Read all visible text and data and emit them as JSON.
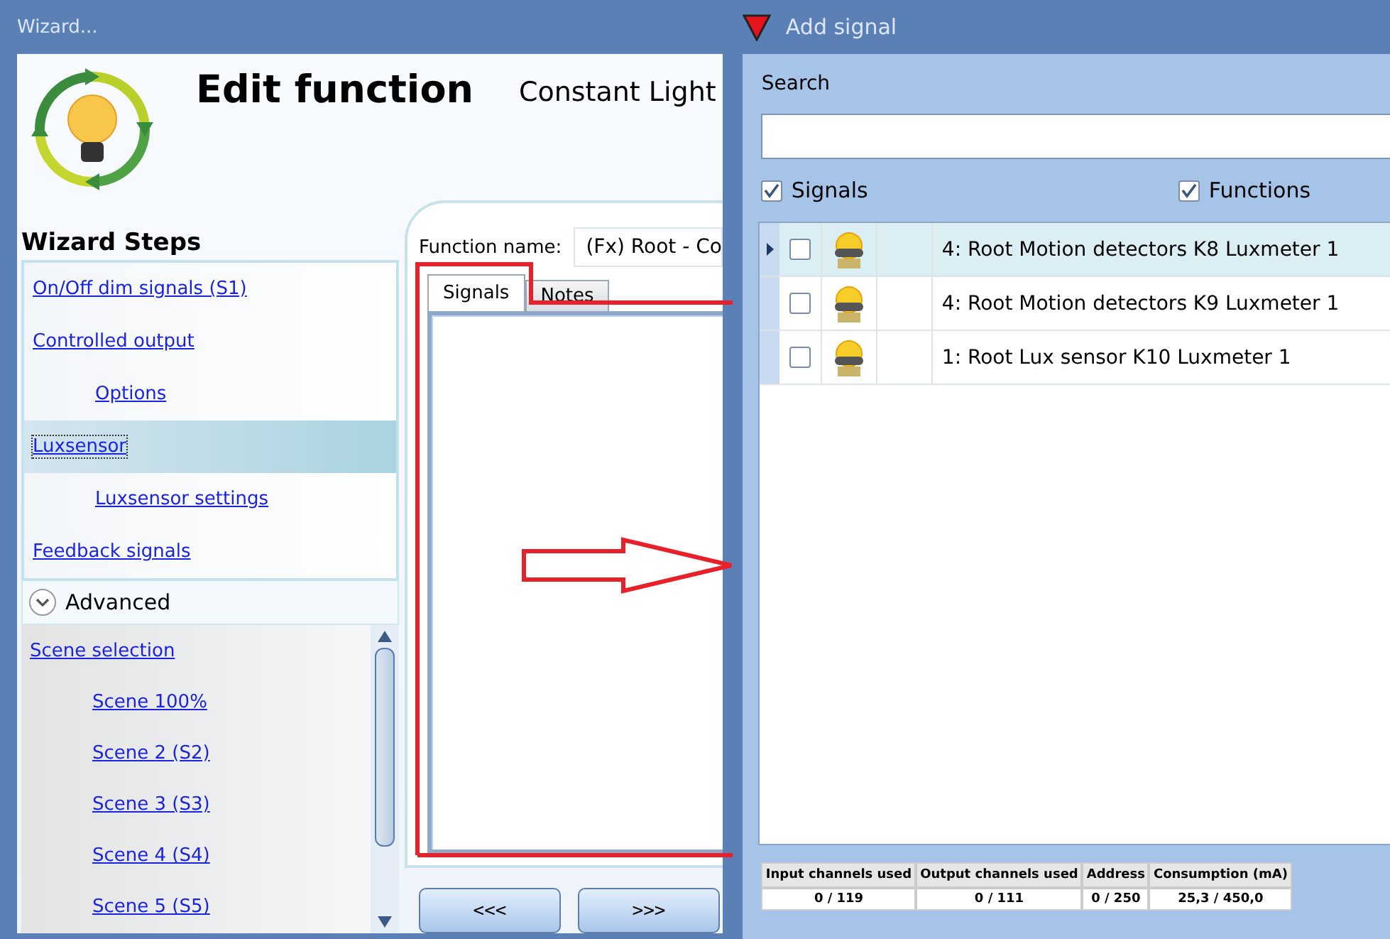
{
  "wizard": {
    "title": "Wizard...",
    "heading": "Edit function",
    "function_type": "Constant Light",
    "steps_title": "Wizard Steps",
    "steps": [
      {
        "label": "On/Off dim signals (S1)",
        "selected": false
      },
      {
        "label": "Controlled output",
        "selected": false,
        "children": [
          {
            "label": "Options",
            "selected": false
          }
        ]
      },
      {
        "label": "Luxsensor",
        "selected": true,
        "children": [
          {
            "label": "Luxsensor settings",
            "selected": false
          }
        ]
      },
      {
        "label": "Feedback signals",
        "selected": false
      }
    ],
    "advanced": {
      "label": "Advanced",
      "expanded": true,
      "steps": [
        {
          "label": "Scene selection",
          "selected": false,
          "children": [
            {
              "label": "Scene 100%",
              "selected": false
            },
            {
              "label": "Scene 2 (S2)",
              "selected": false
            },
            {
              "label": "Scene 3 (S3)",
              "selected": false
            },
            {
              "label": "Scene 4 (S4)",
              "selected": false
            },
            {
              "label": "Scene 5 (S5)",
              "selected": false
            }
          ]
        }
      ]
    },
    "function_name": {
      "label": "Function name:",
      "value": "(Fx) Root - Co"
    },
    "tabs": [
      {
        "label": "Signals",
        "selected": true
      },
      {
        "label": "Notes",
        "selected": false
      }
    ],
    "buttons": [
      "<<<",
      ">>>"
    ]
  },
  "add_signal": {
    "title": "Add signal",
    "search": {
      "label": "Search"
    },
    "filters": [
      {
        "label": "Signals",
        "checked": true
      },
      {
        "label": "Functions",
        "checked": true
      }
    ],
    "rows": [
      {
        "text": "4: Root Motion detectors K8 Luxmeter 1",
        "selected": true,
        "checked": false
      },
      {
        "text": "4: Root Motion detectors K9 Luxmeter 1",
        "selected": false,
        "checked": false
      },
      {
        "text": "1: Root Lux sensor K10 Luxmeter 1",
        "selected": false,
        "checked": false
      }
    ],
    "usage": [
      {
        "header": "Input channels used",
        "value": "0 / 119"
      },
      {
        "header": "Output channels used",
        "value": "0 / 111"
      },
      {
        "header": "Address",
        "value": "0 / 250"
      },
      {
        "header": "Consumption (mA)",
        "value": "25,3 / 450,0"
      }
    ]
  }
}
